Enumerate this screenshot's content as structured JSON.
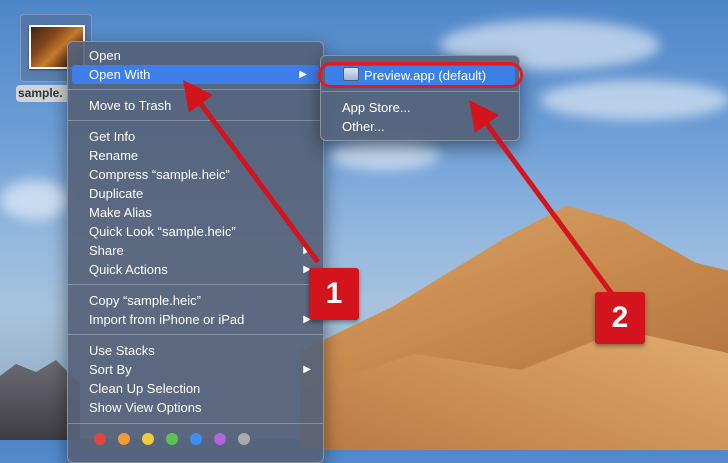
{
  "desktop": {
    "file_label": "sample."
  },
  "context_menu": {
    "items": [
      {
        "label": "Open"
      },
      {
        "label": "Open With"
      },
      {
        "label": "Move to Trash"
      },
      {
        "label": "Get Info"
      },
      {
        "label": "Rename"
      },
      {
        "label": "Compress “sample.heic”"
      },
      {
        "label": "Duplicate"
      },
      {
        "label": "Make Alias"
      },
      {
        "label": "Quick Look “sample.heic”"
      },
      {
        "label": "Share"
      },
      {
        "label": "Quick Actions"
      },
      {
        "label": "Copy “sample.heic”"
      },
      {
        "label": "Import from iPhone or iPad"
      },
      {
        "label": "Use Stacks"
      },
      {
        "label": "Sort By"
      },
      {
        "label": "Clean Up Selection"
      },
      {
        "label": "Show View Options"
      }
    ],
    "tag_colors": [
      "#e0453f",
      "#f19a37",
      "#f3cc3d",
      "#5cc351",
      "#3c8ef0",
      "#b066d6",
      "#a9a9ae"
    ]
  },
  "submenu": {
    "items": [
      {
        "label": "Preview.app (default)",
        "icon": "preview-app-icon"
      },
      {
        "label": "App Store..."
      },
      {
        "label": "Other..."
      }
    ]
  },
  "annotations": {
    "badge_1": "1",
    "badge_2": "2",
    "accent": "#d4141c"
  }
}
